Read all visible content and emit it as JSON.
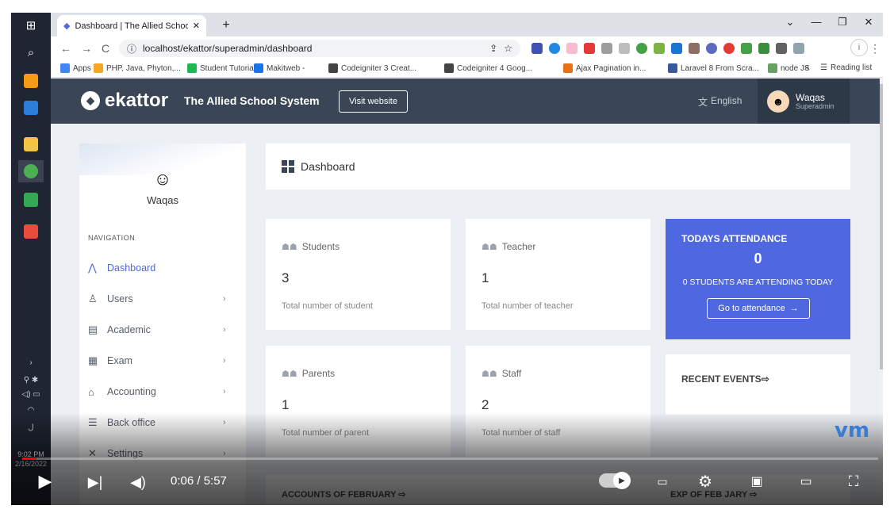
{
  "browser": {
    "tab_title": "Dashboard | The Allied School Sy",
    "url": "localhost/ekattor/superadmin/dashboard",
    "bookmarks": [
      {
        "label": "Apps",
        "color": "#4285f4"
      },
      {
        "label": "PHP, Java, Phyton,...",
        "color": "#f5a623"
      },
      {
        "label": "Student Tutorial",
        "color": "#1db954"
      },
      {
        "label": "Makitweb -",
        "color": "#1a73e8"
      },
      {
        "label": "Codeigniter 3 Creat...",
        "color": "#444444"
      },
      {
        "label": "Codeigniter 4 Goog...",
        "color": "#444444"
      },
      {
        "label": "Ajax Pagination in...",
        "color": "#e8711a"
      },
      {
        "label": "Laravel 8 From Scra...",
        "color": "#3b5998"
      },
      {
        "label": "node JS",
        "color": "#68a063"
      }
    ],
    "reading_list": "Reading list",
    "more": "»"
  },
  "app": {
    "logo": "ekattor",
    "school_name": "The Allied School System",
    "visit_button": "Visit website",
    "language": "English",
    "user_name": "Waqas",
    "user_role": "Superadmin"
  },
  "sidebar": {
    "profile_name": "Waqas",
    "nav_heading": "NAVIGATION",
    "items": [
      {
        "label": "Dashboard",
        "icon": "dashboard-icon",
        "glyph": "⋀",
        "arrow": ""
      },
      {
        "label": "Users",
        "icon": "user-icon",
        "glyph": "♙",
        "arrow": "›"
      },
      {
        "label": "Academic",
        "icon": "academic-icon",
        "glyph": "▤",
        "arrow": "›"
      },
      {
        "label": "Exam",
        "icon": "exam-icon",
        "glyph": "▦",
        "arrow": "›"
      },
      {
        "label": "Accounting",
        "icon": "accounting-icon",
        "glyph": "⌂",
        "arrow": "›"
      },
      {
        "label": "Back office",
        "icon": "back-office-icon",
        "glyph": "☰",
        "arrow": "›"
      },
      {
        "label": "Settings",
        "icon": "settings-icon",
        "glyph": "✕",
        "arrow": "›"
      }
    ]
  },
  "dashboard": {
    "title": "Dashboard",
    "cards": [
      {
        "title": "Students",
        "value": "3",
        "sub": "Total number of student"
      },
      {
        "title": "Teacher",
        "value": "1",
        "sub": "Total number of teacher"
      },
      {
        "title": "Parents",
        "value": "1",
        "sub": "Total number of parent"
      },
      {
        "title": "Staff",
        "value": "2",
        "sub": "Total number of staff"
      }
    ],
    "attendance": {
      "title": "TODAYS ATTENDANCE",
      "count": "0",
      "text": "0 STUDENTS ARE ATTENDING TODAY",
      "button": "Go to attendance"
    },
    "recent_events": "RECENT EVENTS",
    "accounts": "ACCOUNTS OF FEBRUARY",
    "expenses": "EXP   OF FEB   JARY"
  },
  "video": {
    "time": "0:06 / 5:57",
    "progress_fraction": 0.017,
    "watermark": "vm"
  },
  "system": {
    "time": "9:02 PM",
    "date": "2/16/2022"
  },
  "colors": {
    "accent": "#4f68e0",
    "topbar": "#3a4656",
    "progress": "#ff0000"
  }
}
